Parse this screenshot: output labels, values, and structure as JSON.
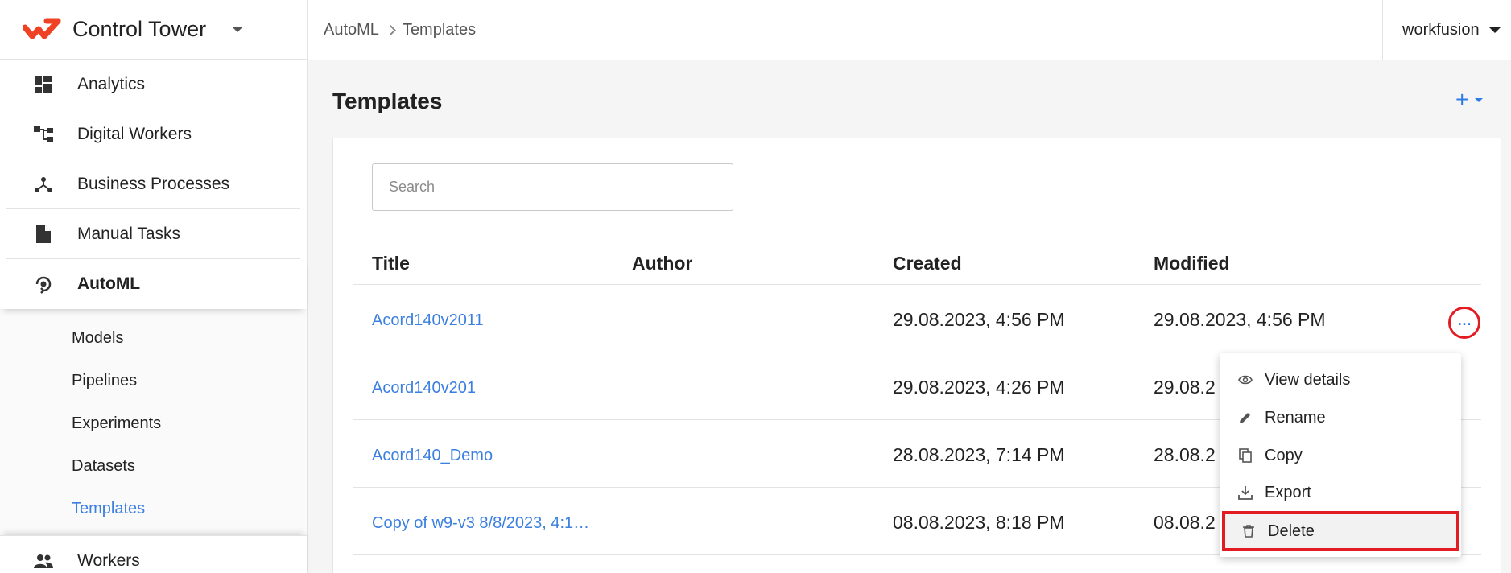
{
  "app": {
    "name": "Control Tower"
  },
  "brand_colors": {
    "accent": "#2f7be5",
    "logo": "#ef4123",
    "highlight": "#e31b23"
  },
  "sidebar": {
    "items": [
      {
        "label": "Analytics",
        "icon": "dashboard-icon"
      },
      {
        "label": "Digital Workers",
        "icon": "hierarchy-icon"
      },
      {
        "label": "Business Processes",
        "icon": "process-icon"
      },
      {
        "label": "Manual Tasks",
        "icon": "document-icon"
      },
      {
        "label": "AutoML",
        "icon": "automl-icon"
      }
    ],
    "sub_items": [
      "Models",
      "Pipelines",
      "Experiments",
      "Datasets",
      "Templates"
    ],
    "workers": {
      "label": "Workers",
      "icon": "people-icon"
    }
  },
  "header": {
    "breadcrumb": [
      "AutoML",
      "Templates"
    ],
    "user": "workfusion"
  },
  "main": {
    "title": "Templates",
    "add_label": "+",
    "search_placeholder": "Search",
    "columns": [
      "Title",
      "Author",
      "Created",
      "Modified"
    ],
    "rows": [
      {
        "title": "Acord140v2011",
        "author": "",
        "created": "29.08.2023, 4:56 PM",
        "modified": "29.08.2023, 4:56 PM"
      },
      {
        "title": "Acord140v201",
        "author": "",
        "created": "29.08.2023, 4:26 PM",
        "modified": "29.08.2"
      },
      {
        "title": "Acord140_Demo",
        "author": "",
        "created": "28.08.2023, 7:14 PM",
        "modified": "28.08.2"
      },
      {
        "title": "Copy of w9-v3 8/8/2023, 4:1…",
        "author": "",
        "created": "08.08.2023, 8:18 PM",
        "modified": "08.08.2"
      }
    ],
    "more_label": "…"
  },
  "context_menu": {
    "items": [
      {
        "label": "View details",
        "icon": "eye-icon"
      },
      {
        "label": "Rename",
        "icon": "pencil-icon"
      },
      {
        "label": "Copy",
        "icon": "copy-icon"
      },
      {
        "label": "Export",
        "icon": "download-icon"
      },
      {
        "label": "Delete",
        "icon": "trash-icon"
      }
    ]
  }
}
